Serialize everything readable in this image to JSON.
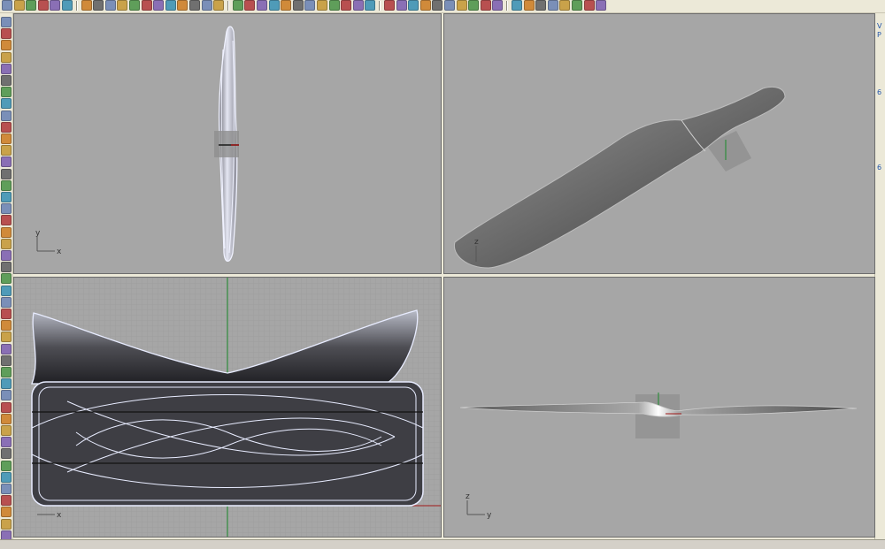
{
  "toolbar": {
    "icons": [
      "new-icon",
      "open-icon",
      "save-icon",
      "print-icon",
      "import-icon",
      "export-icon",
      "cut-icon",
      "copy-icon",
      "paste-icon",
      "undo-icon",
      "redo-icon",
      "pan-icon",
      "rotate-icon",
      "zoom-icon",
      "zoom-window-icon",
      "zoom-extents-icon",
      "zoom-selected-icon",
      "undo-view-icon",
      "select-icon",
      "grid-icon",
      "snap-icon",
      "layer-icon",
      "light-icon",
      "material-icon",
      "color-wheel-icon",
      "shade-icon",
      "render-icon",
      "sphere-icon",
      "options-icon",
      "help-icon"
    ],
    "view_icons": [
      "top-view-icon",
      "front-view-icon",
      "right-view-icon",
      "persp-view-icon",
      "bottom-view-icon",
      "left-view-icon",
      "back-view-icon",
      "view-8-icon",
      "view-9-icon",
      "view-10-icon"
    ],
    "layout_icons": [
      "tile-1-icon",
      "tile-2-icon",
      "tile-3-icon",
      "tile-4-icon",
      "tile-5-icon",
      "tile-6-icon",
      "tile-7-icon",
      "tile-8-icon"
    ]
  },
  "left_toolbar": {
    "icons": [
      "point-icon",
      "polyline-icon",
      "line-icon",
      "rectangle-icon",
      "circle-icon",
      "arc-icon",
      "ellipse-icon",
      "curve-icon",
      "fillet-icon",
      "offset-icon",
      "surface-icon",
      "loft-icon",
      "extrude-icon",
      "sweep-icon",
      "revolve-icon",
      "box-icon",
      "sphere-solid-icon",
      "cylinder-icon",
      "boolean-icon",
      "mesh-icon",
      "transform-icon",
      "mirror-icon",
      "array-icon",
      "scale-icon",
      "trim-icon",
      "split-icon",
      "join-icon",
      "explode-icon",
      "group-icon",
      "analyze-icon",
      "render-tool-icon",
      "dimension-icon",
      "text-icon",
      "hatch-icon",
      "properties-icon",
      "layers-tool-icon",
      "osnap-icon",
      "grid-tool-icon",
      "gumball-icon",
      "history-icon",
      "block-icon",
      "delete-icon",
      "cage-icon",
      "flow-icon",
      "twist-icon",
      "taper-icon"
    ]
  },
  "right_panel": {
    "items": [
      "V",
      "P",
      "6",
      "6"
    ]
  },
  "viewports": {
    "top": {
      "axis_y": "y",
      "axis_x": "x"
    },
    "perspective": {
      "axis_z": "z"
    },
    "front": {
      "axis_x": "x"
    },
    "right": {
      "axis_z": "z",
      "axis_y": "y"
    }
  },
  "colors": {
    "viewport_bg": "#a6a6a6",
    "grid_line": "#989898",
    "x_axis": "#a01818",
    "y_axis": "#1a8a2a",
    "wireframe": "#e8ecff",
    "ui_face": "#ece9d8"
  }
}
